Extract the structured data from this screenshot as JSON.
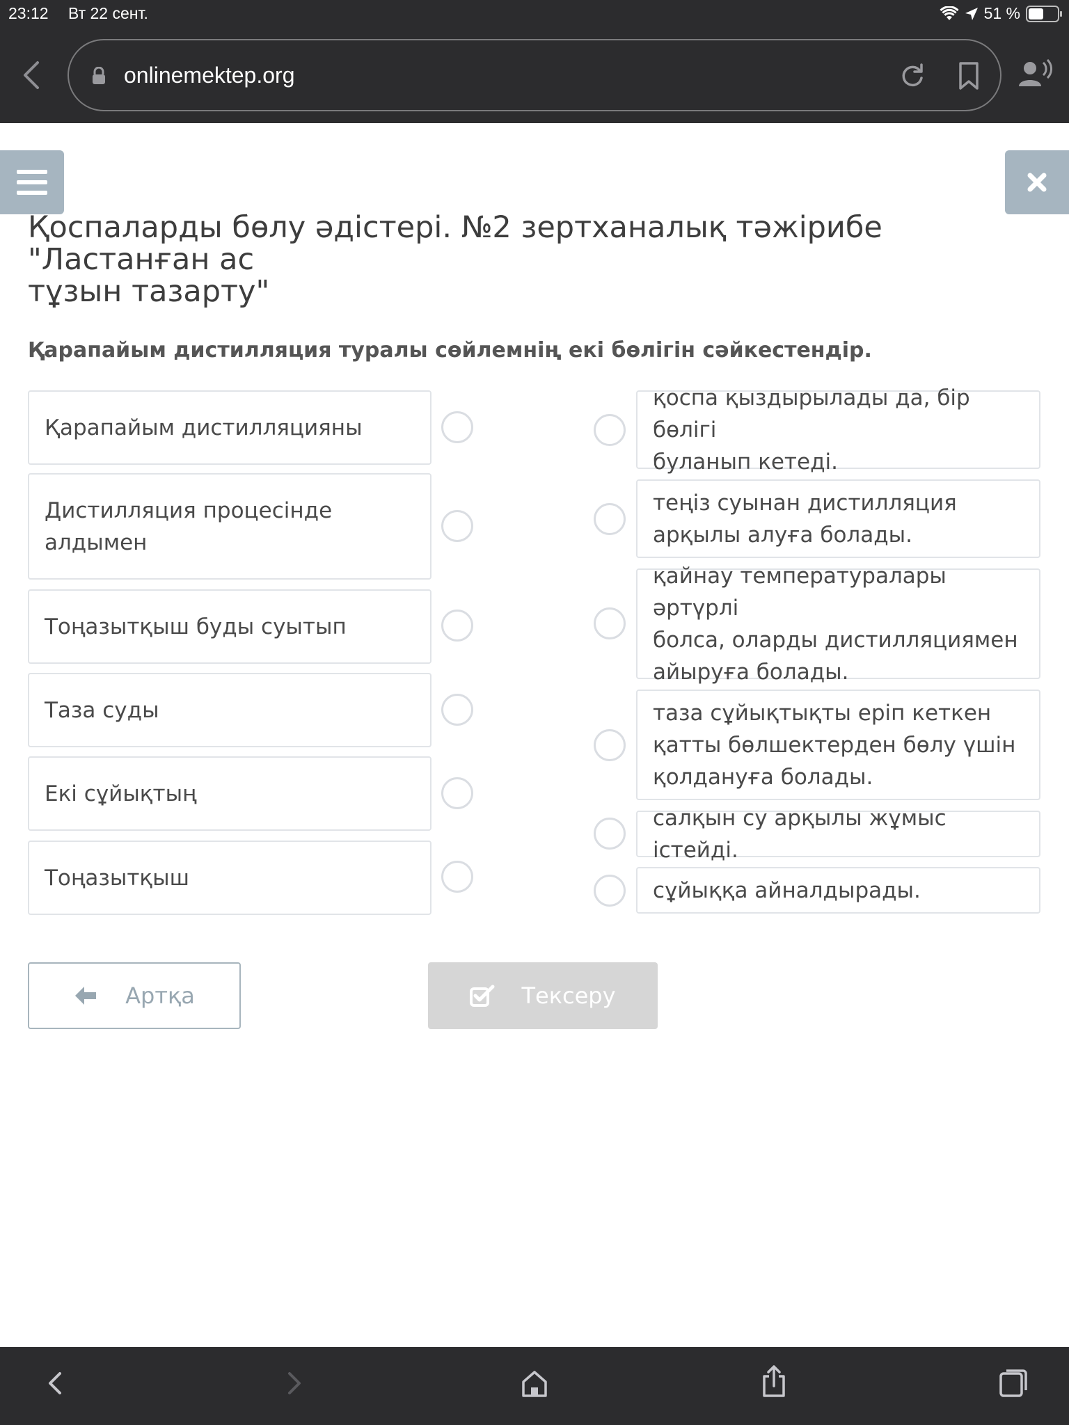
{
  "status_bar": {
    "time": "23:12",
    "date": "Вт 22 сент.",
    "battery_text": "51 %",
    "battery_level": 0.51
  },
  "browser": {
    "url": "onlinemektep.org",
    "icons": [
      "back-arrow-icon",
      "lock-icon",
      "reload-icon",
      "bookmark-icon",
      "user-audio-icon"
    ]
  },
  "lesson": {
    "title_line1": "Қоспаларды бөлу әдістері. №2 зертханалық тәжірибе \"Ластанған ас",
    "title_line2": "тұзын тазарту\"",
    "question": "Қарапайым дистилляция туралы сөйлемнің екі бөлігін сәйкестендір.",
    "left_items": [
      {
        "lines": [
          "Қарапайым дистилляцияны"
        ]
      },
      {
        "lines": [
          "Дистилляция процесінде",
          "алдымен"
        ]
      },
      {
        "lines": [
          "Тоңазытқыш буды суытып"
        ]
      },
      {
        "lines": [
          "Таза суды"
        ]
      },
      {
        "lines": [
          "Екі сұйықтың"
        ]
      },
      {
        "lines": [
          "Тоңазытқыш"
        ]
      }
    ],
    "right_items": [
      {
        "lines": [
          "қоспа қыздырылады да, бір бөлігі",
          "буланып кетеді."
        ]
      },
      {
        "lines": [
          "теңіз суынан дистилляция",
          "арқылы алуға болады."
        ]
      },
      {
        "lines": [
          "қайнау температуралары әртүрлі",
          "болса, оларды дистилляциямен",
          "айыруға болады."
        ]
      },
      {
        "lines": [
          "таза сұйықтықты еріп кеткен",
          "қатты бөлшектерден бөлу үшін",
          "қолдануға болады."
        ]
      },
      {
        "lines": [
          "салқын су арқылы жұмыс істейді."
        ]
      },
      {
        "lines": [
          "сұйыққа айналдырады."
        ]
      }
    ],
    "back_label": "Артқа",
    "check_label": "Тексеру"
  },
  "colors": {
    "chrome": "#2c2c2e",
    "button_grey_blue": "#a6b5c0",
    "border": "#e1e4e8",
    "disabled": "#d6d6d6"
  }
}
